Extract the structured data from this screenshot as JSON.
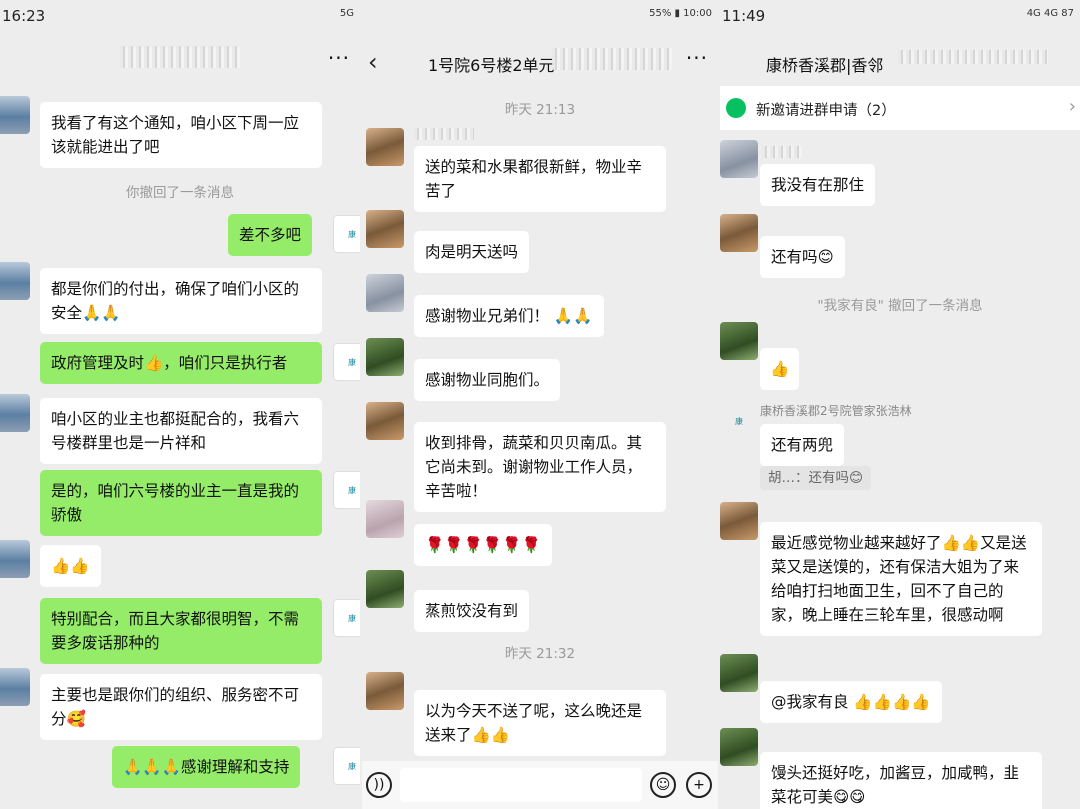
{
  "p1": {
    "time": "16:23",
    "status_right": "5G",
    "dots": "···",
    "msgs": {
      "m1": "我看了有这个通知，咱小区下周一应该就能进出了吧",
      "sys": "你撤回了一条消息",
      "m2": "差不多吧",
      "m3": "都是你们的付出，确保了咱们小区的安全🙏🙏",
      "m4": "政府管理及时👍，咱们只是执行者",
      "m5": "咱小区的业主也都挺配合的，我看六号楼群里也是一片祥和",
      "m6": "是的，咱们六号楼的业主一直是我的骄傲",
      "m7": "👍👍",
      "m8": "特别配合，而且大家都很明智，不需要多废话那种的",
      "m9": "主要也是跟你们的组织、服务密不可分🥰",
      "m10": "🙏🙏🙏感谢理解和支持"
    }
  },
  "p2": {
    "status_right": "55% ▮ 10:00",
    "back": "‹",
    "title": "1号院6号楼2单元",
    "dots": "···",
    "time1": "昨天 21:13",
    "time2": "昨天 21:32",
    "msgs": {
      "m1": "送的菜和水果都很新鲜，物业辛苦了",
      "m2": "肉是明天送吗",
      "m3": "感谢物业兄弟们！ 🙏🙏",
      "m4": "感谢物业同胞们。",
      "m5": "收到排骨，蔬菜和贝贝南瓜。其它尚未到。谢谢物业工作人员，辛苦啦！",
      "m6": "🌹🌹🌹🌹🌹🌹",
      "m7": "蒸煎饺没有到",
      "m8": "以为今天不送了呢，这么晚还是送来了👍👍"
    },
    "voice_icon": "))",
    "emoji_icon": "☺",
    "plus_icon": "+"
  },
  "p3": {
    "time": "11:49",
    "status_right": "4G  4G  87",
    "title": "康桥香溪郡|香邻",
    "dots": "···",
    "banner": "新邀请进群申请（2）",
    "chev": "›",
    "sys": "\"我家有良\" 撤回了一条消息",
    "name_manager": "康桥香溪郡2号院管家张浩林",
    "msgs": {
      "m1": "我没有在那住",
      "m2": "还有吗😊",
      "m3": "👍",
      "m4": "还有两兜",
      "quote": "胡…：还有吗😊",
      "m5": "最近感觉物业越来越好了👍👍又是送菜又是送馍的，还有保洁大姐为了来给咱打扫地面卫生，回不了自己的家，晚上睡在三轮车里，很感动啊",
      "m6": "@我家有良 👍👍👍👍",
      "m7": "馒头还挺好吃，加酱豆，加咸鸭，韭菜花可美😋😋"
    }
  },
  "colors": {
    "bubble_me": "#95ec69",
    "bubble_other": "#ffffff",
    "bg": "#ededed",
    "accent": "#07c160"
  }
}
